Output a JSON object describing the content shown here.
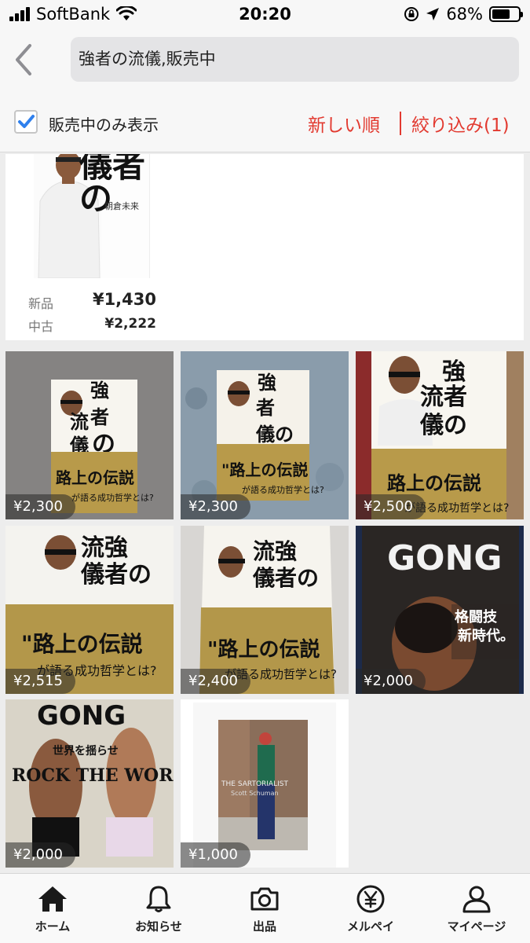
{
  "status_bar": {
    "carrier": "SoftBank",
    "time": "20:20",
    "battery": "68%",
    "battery_level": 0.68
  },
  "search": {
    "query": "強者の流儀,販売中"
  },
  "filter_bar": {
    "checkbox_label": "販売中のみ表示",
    "checked": true,
    "sort_label": "新しい順",
    "filter_label": "絞り込み(1)"
  },
  "featured": {
    "cover_title": "儀者の",
    "cover_author": "朝倉未来",
    "new_label": "新品",
    "new_price": "¥1,430",
    "used_label": "中古",
    "used_price": "¥2,222"
  },
  "items": [
    {
      "price": "¥2,300"
    },
    {
      "price": "¥2,300"
    },
    {
      "price": "¥2,500"
    },
    {
      "price": "¥2,515"
    },
    {
      "price": "¥2,400"
    },
    {
      "price": "¥2,000"
    },
    {
      "price": "¥2,000"
    },
    {
      "price": "¥1,000"
    }
  ],
  "tabs": [
    {
      "label": "ホーム",
      "icon": "home-icon"
    },
    {
      "label": "お知らせ",
      "icon": "bell-icon"
    },
    {
      "label": "出品",
      "icon": "camera-icon"
    },
    {
      "label": "メルペイ",
      "icon": "yen-icon"
    },
    {
      "label": "マイページ",
      "icon": "person-icon"
    }
  ],
  "colors": {
    "accent": "#e23a30",
    "checkbox": "#2f80ed"
  }
}
